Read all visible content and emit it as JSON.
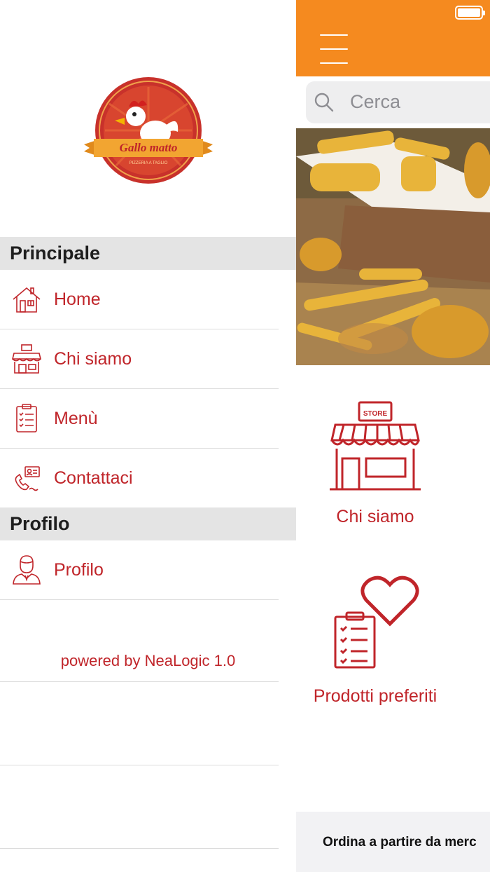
{
  "drawer": {
    "logo_text": "Gallo matto",
    "logo_subtext": "PIZZERIA A TAGLIO",
    "sections": [
      {
        "title": "Principale",
        "items": [
          {
            "label": "Home",
            "icon": "home-icon"
          },
          {
            "label": "Chi siamo",
            "icon": "store-icon"
          },
          {
            "label": "Menù",
            "icon": "clipboard-list-icon"
          },
          {
            "label": "Contattaci",
            "icon": "phone-contact-icon"
          }
        ]
      },
      {
        "title": "Profilo",
        "items": [
          {
            "label": "Profilo",
            "icon": "user-icon"
          }
        ]
      }
    ],
    "powered_by": "powered by NeaLogic 1.0"
  },
  "main": {
    "search": {
      "placeholder": "Cerca"
    },
    "tiles": [
      {
        "label": "Chi siamo",
        "icon": "store-icon",
        "icon_text": "STORE"
      },
      {
        "label": "Prodotti preferiti",
        "icon": "favorite-list-icon"
      }
    ],
    "footer_text": "Ordina a partire da merc"
  },
  "colors": {
    "accent": "#c0252a",
    "topbar": "#f58a1f",
    "section_bg": "#e4e4e4"
  }
}
